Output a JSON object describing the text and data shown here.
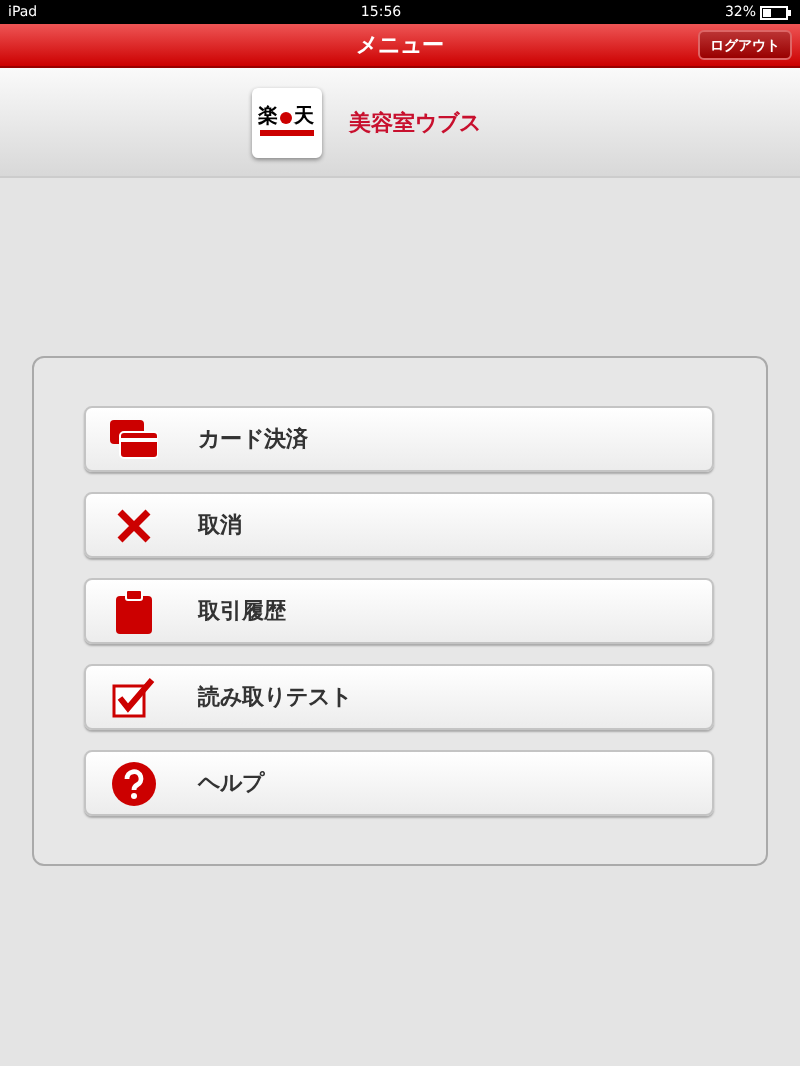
{
  "status_bar": {
    "device": "iPad",
    "time": "15:56",
    "battery": "32%"
  },
  "nav_bar": {
    "title": "メニュー",
    "logout_button": "ログアウト"
  },
  "store": {
    "logo": {
      "left": "楽",
      "right": "天"
    },
    "name": "美容室ウブス"
  },
  "menu": [
    {
      "kind": "card",
      "label": "カード決済"
    },
    {
      "kind": "cancel",
      "label": "取消"
    },
    {
      "kind": "history",
      "label": "取引履歴"
    },
    {
      "kind": "test",
      "label": "読み取りテスト"
    },
    {
      "kind": "help",
      "label": "ヘルプ"
    }
  ]
}
